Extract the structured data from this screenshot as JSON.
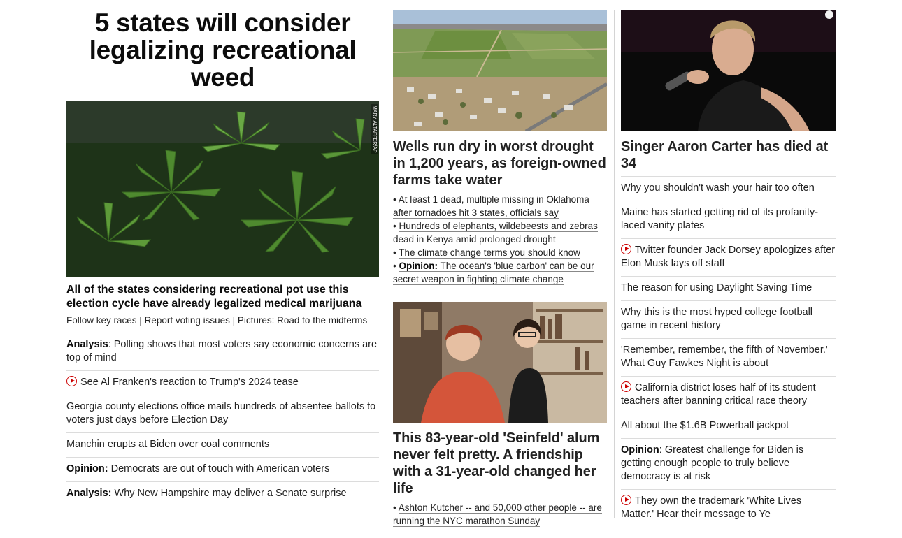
{
  "main": {
    "headline": "5 states will consider legalizing recreational weed",
    "image_credit": "MARY ALTAFFER/AP",
    "dek": "All of the states considering recreational pot use this election cycle have already legalized medical marijuana",
    "related_links": [
      "Follow key races",
      "Report voting issues",
      "Pictures: Road to the midterms"
    ],
    "related_separator": " | ",
    "stories": [
      {
        "label": "Analysis",
        "text": ": Polling shows that most voters say economic concerns are top of mind",
        "video": false
      },
      {
        "label": "",
        "text": "See Al Franken's reaction to Trump's 2024 tease",
        "video": true
      },
      {
        "label": "",
        "text": "Georgia county elections office mails hundreds of absentee ballots to voters just days before Election Day",
        "video": false
      },
      {
        "label": "",
        "text": "Manchin erupts at Biden over coal comments",
        "video": false
      },
      {
        "label": "Opinion:",
        "text": " Democrats are out of touch with American voters",
        "video": false
      },
      {
        "label": "Analysis:",
        "text": " Why New Hampshire may deliver a Senate surprise",
        "video": false
      }
    ]
  },
  "drought": {
    "headline": "Wells run dry in worst drought in 1,200 years, as foreign-owned farms take water",
    "bullet_char": "• ",
    "bullets": [
      {
        "label": "",
        "text": "At least 1 dead, multiple missing in Oklahoma after tornadoes hit 3 states, officials say"
      },
      {
        "label": "",
        "text": "Hundreds of elephants, wildebeests and zebras dead in Kenya amid prolonged drought"
      },
      {
        "label": "",
        "text": "The climate change terms you should know"
      },
      {
        "label": "Opinion:",
        "text": " The ocean's 'blue carbon' can be our secret weapon in fighting climate change"
      }
    ]
  },
  "seinfeld": {
    "headline": "This 83-year-old 'Seinfeld' alum never felt pretty. A friendship with a 31-year-old changed her life",
    "bullet_char": "• ",
    "bullets": [
      {
        "label": "",
        "text": "Ashton Kutcher -- and 50,000 other people -- are running the NYC marathon Sunday"
      }
    ]
  },
  "singer": {
    "headline": "Singer Aaron Carter has died at 34",
    "stories": [
      {
        "label": "",
        "text": "Why you shouldn't wash your hair too often",
        "video": false
      },
      {
        "label": "",
        "text": "Maine has started getting rid of its profanity-laced vanity plates",
        "video": false
      },
      {
        "label": "",
        "text": "Twitter founder Jack Dorsey apologizes after Elon Musk lays off staff",
        "video": true
      },
      {
        "label": "",
        "text": "The reason for using Daylight Saving Time",
        "video": false
      },
      {
        "label": "",
        "text": "Why this is the most hyped college football game in recent history",
        "video": false
      },
      {
        "label": "",
        "text": "'Remember, remember, the fifth of November.' What Guy Fawkes Night is about",
        "video": false
      },
      {
        "label": "",
        "text": "California district loses half of its student teachers after banning critical race theory",
        "video": true
      },
      {
        "label": "",
        "text": "All about the $1.6B Powerball jackpot",
        "video": false
      },
      {
        "label": "Opinion",
        "text": ": Greatest challenge for Biden is getting enough people to truly believe democracy is at risk",
        "video": false
      },
      {
        "label": "",
        "text": "They own the trademark 'White Lives Matter.' Hear their message to Ye",
        "video": true
      }
    ]
  },
  "colors": {
    "accent_red": "#cc0000",
    "divider": "#dcdcdc",
    "text": "#0c0c0c"
  },
  "icons": {
    "video": "play-circle-icon"
  }
}
